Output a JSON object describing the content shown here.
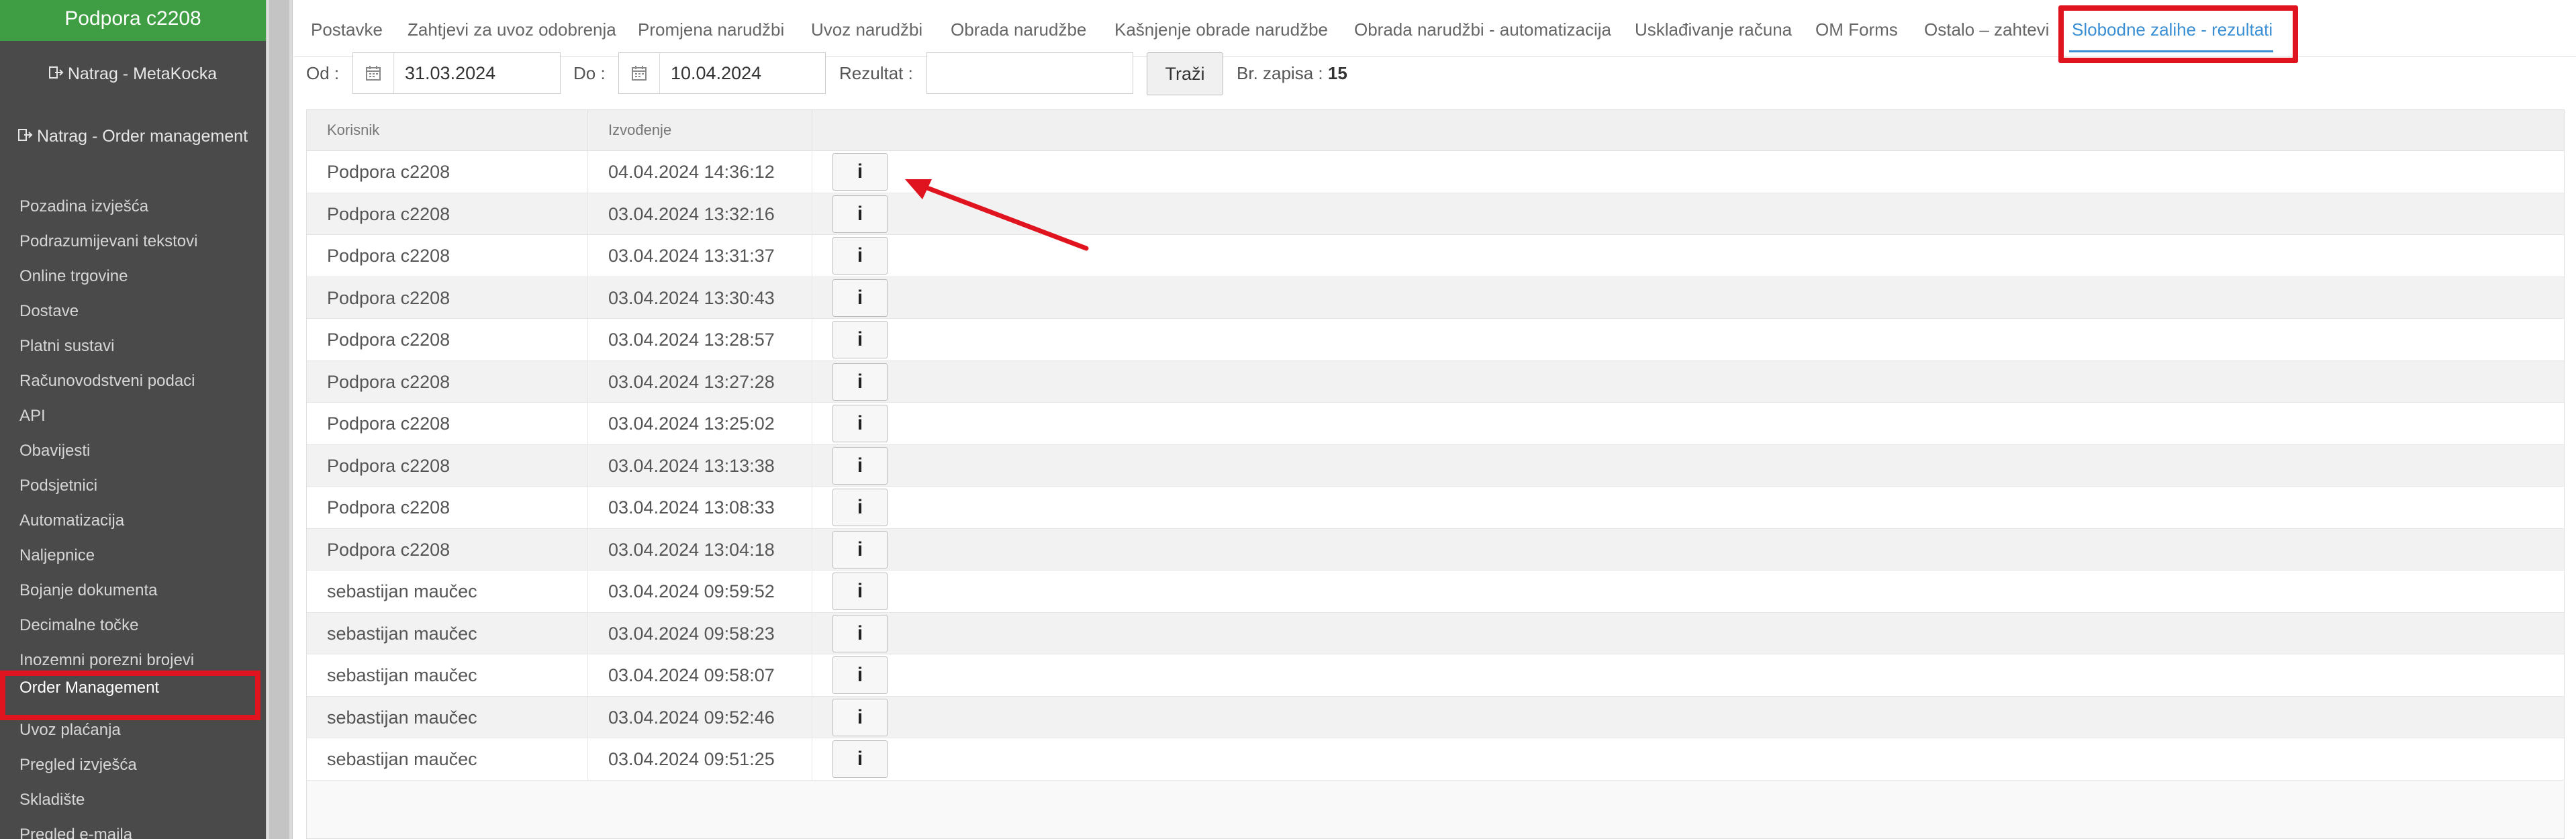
{
  "sidebar": {
    "header": "Podpora c2208",
    "back_links": [
      "Natrag - MetaKocka",
      "Natrag - Order management"
    ],
    "items": [
      {
        "label": "Pozadina izvješća",
        "active": false
      },
      {
        "label": "Podrazumijevani tekstovi",
        "active": false
      },
      {
        "label": "Online trgovine",
        "active": false
      },
      {
        "label": "Dostave",
        "active": false
      },
      {
        "label": "Platni sustavi",
        "active": false
      },
      {
        "label": "Računovodstveni podaci",
        "active": false
      },
      {
        "label": "API",
        "active": false
      },
      {
        "label": "Obavijesti",
        "active": false
      },
      {
        "label": "Podsjetnici",
        "active": false
      },
      {
        "label": "Automatizacija",
        "active": false
      },
      {
        "label": "Naljepnice",
        "active": false
      },
      {
        "label": "Bojanje dokumenta",
        "active": false
      },
      {
        "label": "Decimalne točke",
        "active": false
      },
      {
        "label": "Inozemni porezni brojevi",
        "active": false
      },
      {
        "label": "Order Management",
        "active": true
      },
      {
        "label": "Uvoz plaćanja",
        "active": false
      },
      {
        "label": "Pregled izvješća",
        "active": false
      },
      {
        "label": "Skladište",
        "active": false
      },
      {
        "label": "Pregled e-maila",
        "active": false
      }
    ]
  },
  "tabs": [
    "Postavke",
    "Zahtjevi za uvoz odobrenja",
    "Promjena narudžbi",
    "Uvoz narudžbi",
    "Obrada narudžbe",
    "Kašnjenje obrade narudžbe",
    "Obrada narudžbi - automatizacija",
    "Usklađivanje računa",
    "OM Forms",
    "Ostalo – zahtevi",
    "Slobodne zalihe - rezultati"
  ],
  "active_tab": "Slobodne zalihe - rezultati",
  "filters": {
    "from_label": "Od :",
    "from_value": "31.03.2024",
    "to_label": "Do :",
    "to_value": "10.04.2024",
    "result_label": "Rezultat :",
    "result_value": "",
    "search_button": "Traži",
    "count_label": "Br. zapisa :",
    "count_value": "15"
  },
  "table": {
    "columns": [
      "Korisnik",
      "Izvođenje",
      ""
    ],
    "info_label": "i",
    "rows": [
      {
        "user": "Podpora c2208",
        "time": "04.04.2024 14:36:12"
      },
      {
        "user": "Podpora c2208",
        "time": "03.04.2024 13:32:16"
      },
      {
        "user": "Podpora c2208",
        "time": "03.04.2024 13:31:37"
      },
      {
        "user": "Podpora c2208",
        "time": "03.04.2024 13:30:43"
      },
      {
        "user": "Podpora c2208",
        "time": "03.04.2024 13:28:57"
      },
      {
        "user": "Podpora c2208",
        "time": "03.04.2024 13:27:28"
      },
      {
        "user": "Podpora c2208",
        "time": "03.04.2024 13:25:02"
      },
      {
        "user": "Podpora c2208",
        "time": "03.04.2024 13:13:38"
      },
      {
        "user": "Podpora c2208",
        "time": "03.04.2024 13:08:33"
      },
      {
        "user": "Podpora c2208",
        "time": "03.04.2024 13:04:18"
      },
      {
        "user": "sebastijan maučec",
        "time": "03.04.2024 09:59:52"
      },
      {
        "user": "sebastijan maučec",
        "time": "03.04.2024 09:58:23"
      },
      {
        "user": "sebastijan maučec",
        "time": "03.04.2024 09:58:07"
      },
      {
        "user": "sebastijan maučec",
        "time": "03.04.2024 09:52:46"
      },
      {
        "user": "sebastijan maučec",
        "time": "03.04.2024 09:51:25"
      }
    ]
  },
  "colors": {
    "highlight": "#e0141e",
    "accent": "#3a8fd4",
    "sidebar_header": "#3f9e43",
    "sidebar_bg": "#4a4a4a"
  },
  "icons": [
    "sign-out-icon",
    "calendar-icon",
    "info-icon",
    "arrow-annotation"
  ]
}
